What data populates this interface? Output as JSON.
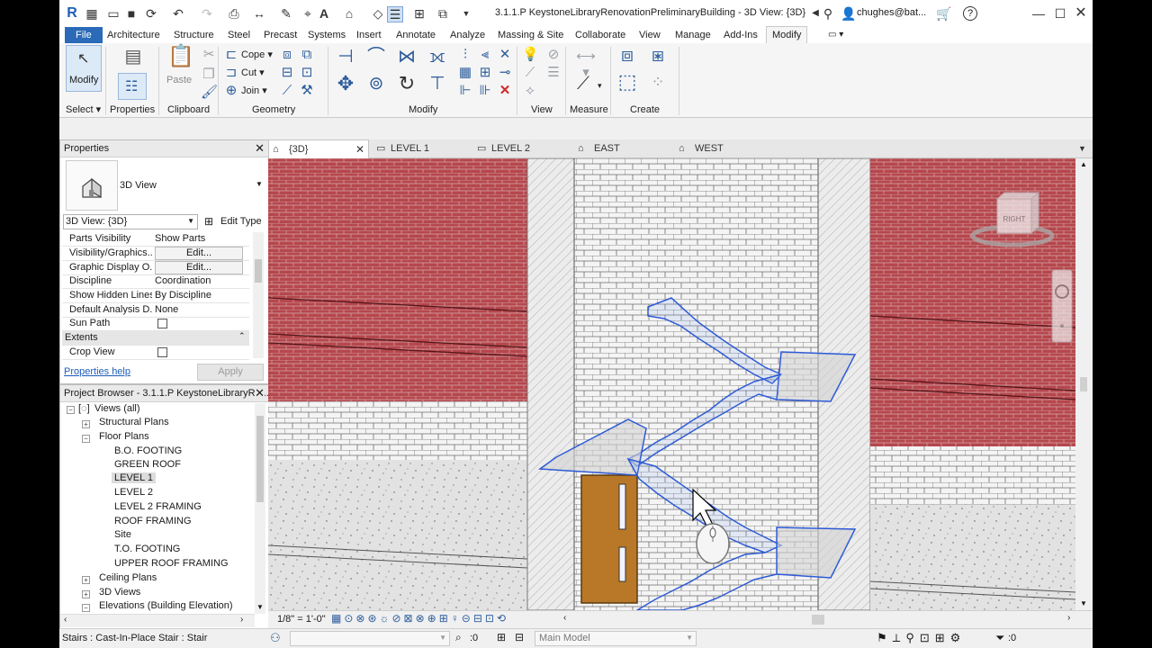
{
  "app": {
    "title": "3.1.1.P KeystoneLibraryRenovationPreliminaryBuilding - 3D View: {3D}",
    "user": "chughes@bat...",
    "help": "?"
  },
  "ribbon_tabs": [
    "File",
    "Architecture",
    "Structure",
    "Steel",
    "Precast",
    "Systems",
    "Insert",
    "Annotate",
    "Analyze",
    "Massing & Site",
    "Collaborate",
    "View",
    "Manage",
    "Add-Ins",
    "Modify"
  ],
  "ribbon": {
    "modify_label": "Modify",
    "paste_label": "Paste",
    "cope_label": "Cope",
    "cut_label": "Cut",
    "join_label": "Join",
    "panels": {
      "select": "Select",
      "properties": "Properties",
      "clipboard": "Clipboard",
      "geometry": "Geometry",
      "modify": "Modify",
      "view": "View",
      "measure": "Measure",
      "create": "Create"
    }
  },
  "properties": {
    "header": "Properties",
    "type_name": "3D View",
    "instance_selector": "3D View: {3D}",
    "edit_type": "Edit Type",
    "rows": [
      {
        "name": "Parts Visibility",
        "value": "Show Parts"
      },
      {
        "name": "Visibility/Graphics...",
        "button": "Edit..."
      },
      {
        "name": "Graphic Display O...",
        "button": "Edit..."
      },
      {
        "name": "Discipline",
        "value": "Coordination"
      },
      {
        "name": "Show Hidden Lines",
        "value": "By Discipline"
      },
      {
        "name": "Default Analysis D...",
        "value": "None"
      },
      {
        "name": "Sun Path",
        "checkbox": true
      }
    ],
    "extents_group": "Extents",
    "crop_view": "Crop View",
    "help_link": "Properties help",
    "apply": "Apply"
  },
  "browser": {
    "header": "Project Browser - 3.1.1.P KeystoneLibraryRe...",
    "root": "Views (all)",
    "structural_plans": "Structural Plans",
    "floor_plans": "Floor Plans",
    "floor_items": [
      "B.O. FOOTING",
      "GREEN ROOF",
      "LEVEL 1",
      "LEVEL 2",
      "LEVEL 2 FRAMING",
      "ROOF FRAMING",
      "Site",
      "T.O. FOOTING",
      "UPPER ROOF FRAMING"
    ],
    "ceiling_plans": "Ceiling Plans",
    "views_3d": "3D Views",
    "elevations": "Elevations (Building Elevation)"
  },
  "view_tabs": [
    "{3D}",
    "LEVEL 1",
    "LEVEL 2",
    "EAST",
    "WEST"
  ],
  "viewcube_face": "RIGHT",
  "view_control": {
    "scale": "1/8\" = 1'-0\""
  },
  "status": {
    "selection": "Stairs : Cast-In-Place Stair : Stair",
    "worksets": ":0",
    "model": "Main Model",
    "filter_count": ":0"
  }
}
